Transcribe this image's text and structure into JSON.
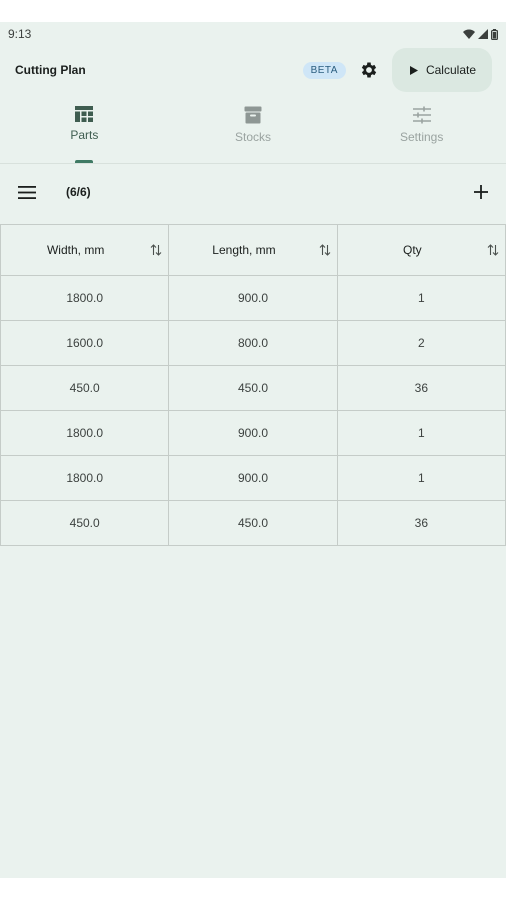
{
  "status_bar": {
    "time": "9:13"
  },
  "app_bar": {
    "title": "Cutting Plan",
    "badge": "BETA",
    "calculate_label": "Calculate"
  },
  "tabs": [
    {
      "label": "Parts",
      "active": true
    },
    {
      "label": "Stocks",
      "active": false
    },
    {
      "label": "Settings",
      "active": false
    }
  ],
  "toolbar": {
    "count": "(6/6)"
  },
  "table": {
    "headers": [
      "Width, mm",
      "Length, mm",
      "Qty"
    ],
    "rows": [
      [
        "1800.0",
        "900.0",
        "1"
      ],
      [
        "1600.0",
        "800.0",
        "2"
      ],
      [
        "450.0",
        "450.0",
        "36"
      ],
      [
        "1800.0",
        "900.0",
        "1"
      ],
      [
        "1800.0",
        "900.0",
        "1"
      ],
      [
        "450.0",
        "450.0",
        "36"
      ]
    ]
  },
  "colors": {
    "background": "#eaf2ee",
    "accent": "#3f7a64",
    "badge_bg": "#cfe6f7",
    "button_bg": "#dbe8e1"
  },
  "icons": [
    "wifi-icon",
    "signal-icon",
    "battery-icon",
    "gear-icon",
    "play-icon",
    "grid-icon",
    "box-icon",
    "sliders-icon",
    "menu-icon",
    "plus-icon",
    "sort-icon"
  ]
}
